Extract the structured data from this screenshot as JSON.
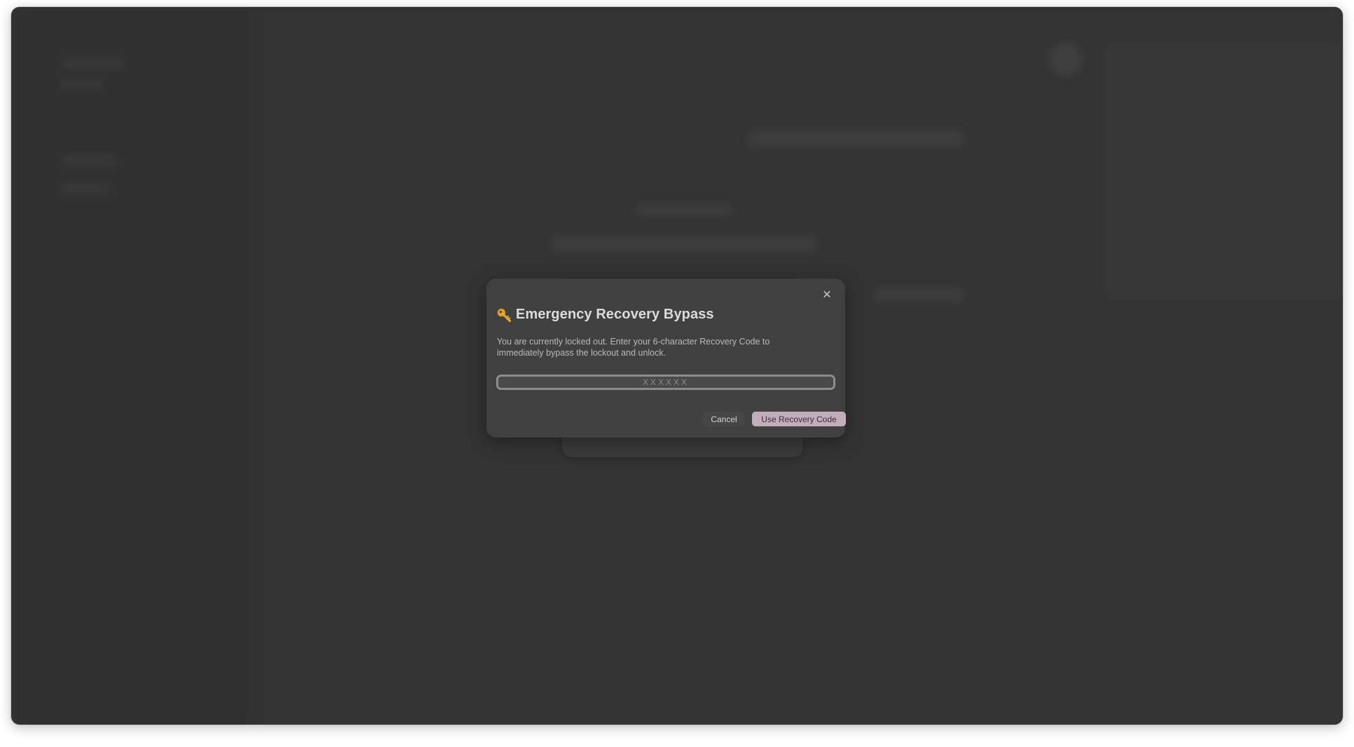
{
  "dialog": {
    "title": "Emergency Recovery Bypass",
    "title_icon": "key-icon",
    "description": "You are currently locked out. Enter your 6-character Recovery Code to immediately bypass the lockout and unlock.",
    "input": {
      "value": "",
      "placeholder": "XXXXXX"
    },
    "close_icon": "close-icon",
    "cancel_label": "Cancel",
    "submit_label": "Use Recovery Code"
  },
  "colors": {
    "window_bg": "#333333",
    "dialog_bg": "#424242",
    "primary_button": "#c4adbb",
    "input_border": "#8d8d8d"
  }
}
